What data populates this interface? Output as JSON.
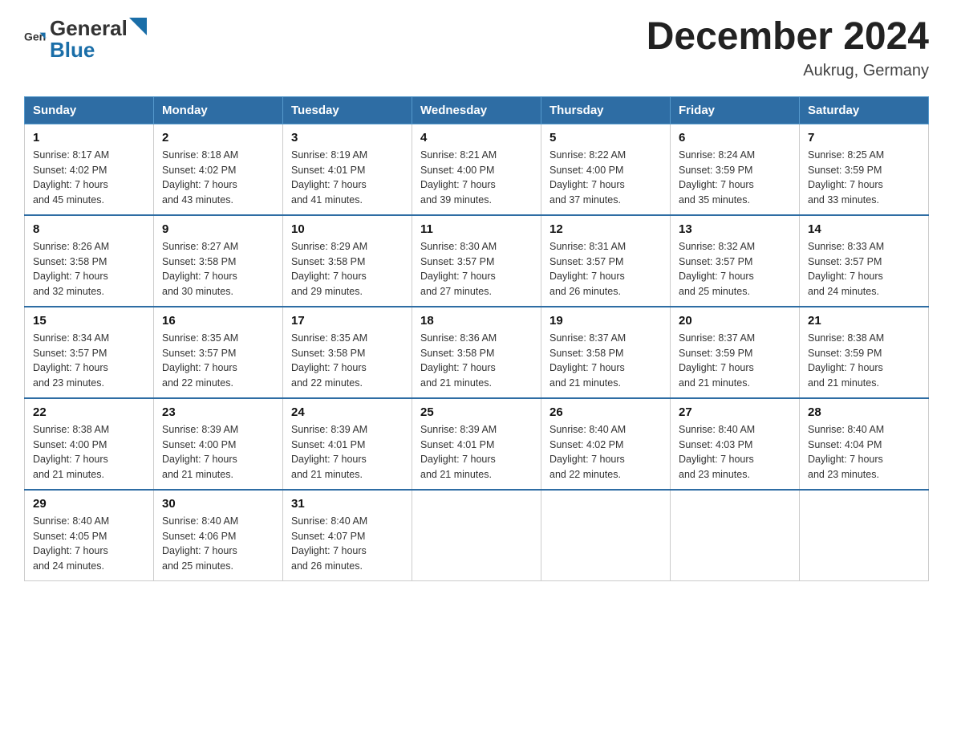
{
  "header": {
    "logo": {
      "text_general": "General",
      "text_blue": "Blue"
    },
    "title": "December 2024",
    "location": "Aukrug, Germany"
  },
  "days_of_week": [
    "Sunday",
    "Monday",
    "Tuesday",
    "Wednesday",
    "Thursday",
    "Friday",
    "Saturday"
  ],
  "weeks": [
    [
      {
        "day": "1",
        "sunrise": "8:17 AM",
        "sunset": "4:02 PM",
        "daylight": "7 hours and 45 minutes."
      },
      {
        "day": "2",
        "sunrise": "8:18 AM",
        "sunset": "4:02 PM",
        "daylight": "7 hours and 43 minutes."
      },
      {
        "day": "3",
        "sunrise": "8:19 AM",
        "sunset": "4:01 PM",
        "daylight": "7 hours and 41 minutes."
      },
      {
        "day": "4",
        "sunrise": "8:21 AM",
        "sunset": "4:00 PM",
        "daylight": "7 hours and 39 minutes."
      },
      {
        "day": "5",
        "sunrise": "8:22 AM",
        "sunset": "4:00 PM",
        "daylight": "7 hours and 37 minutes."
      },
      {
        "day": "6",
        "sunrise": "8:24 AM",
        "sunset": "3:59 PM",
        "daylight": "7 hours and 35 minutes."
      },
      {
        "day": "7",
        "sunrise": "8:25 AM",
        "sunset": "3:59 PM",
        "daylight": "7 hours and 33 minutes."
      }
    ],
    [
      {
        "day": "8",
        "sunrise": "8:26 AM",
        "sunset": "3:58 PM",
        "daylight": "7 hours and 32 minutes."
      },
      {
        "day": "9",
        "sunrise": "8:27 AM",
        "sunset": "3:58 PM",
        "daylight": "7 hours and 30 minutes."
      },
      {
        "day": "10",
        "sunrise": "8:29 AM",
        "sunset": "3:58 PM",
        "daylight": "7 hours and 29 minutes."
      },
      {
        "day": "11",
        "sunrise": "8:30 AM",
        "sunset": "3:57 PM",
        "daylight": "7 hours and 27 minutes."
      },
      {
        "day": "12",
        "sunrise": "8:31 AM",
        "sunset": "3:57 PM",
        "daylight": "7 hours and 26 minutes."
      },
      {
        "day": "13",
        "sunrise": "8:32 AM",
        "sunset": "3:57 PM",
        "daylight": "7 hours and 25 minutes."
      },
      {
        "day": "14",
        "sunrise": "8:33 AM",
        "sunset": "3:57 PM",
        "daylight": "7 hours and 24 minutes."
      }
    ],
    [
      {
        "day": "15",
        "sunrise": "8:34 AM",
        "sunset": "3:57 PM",
        "daylight": "7 hours and 23 minutes."
      },
      {
        "day": "16",
        "sunrise": "8:35 AM",
        "sunset": "3:57 PM",
        "daylight": "7 hours and 22 minutes."
      },
      {
        "day": "17",
        "sunrise": "8:35 AM",
        "sunset": "3:58 PM",
        "daylight": "7 hours and 22 minutes."
      },
      {
        "day": "18",
        "sunrise": "8:36 AM",
        "sunset": "3:58 PM",
        "daylight": "7 hours and 21 minutes."
      },
      {
        "day": "19",
        "sunrise": "8:37 AM",
        "sunset": "3:58 PM",
        "daylight": "7 hours and 21 minutes."
      },
      {
        "day": "20",
        "sunrise": "8:37 AM",
        "sunset": "3:59 PM",
        "daylight": "7 hours and 21 minutes."
      },
      {
        "day": "21",
        "sunrise": "8:38 AM",
        "sunset": "3:59 PM",
        "daylight": "7 hours and 21 minutes."
      }
    ],
    [
      {
        "day": "22",
        "sunrise": "8:38 AM",
        "sunset": "4:00 PM",
        "daylight": "7 hours and 21 minutes."
      },
      {
        "day": "23",
        "sunrise": "8:39 AM",
        "sunset": "4:00 PM",
        "daylight": "7 hours and 21 minutes."
      },
      {
        "day": "24",
        "sunrise": "8:39 AM",
        "sunset": "4:01 PM",
        "daylight": "7 hours and 21 minutes."
      },
      {
        "day": "25",
        "sunrise": "8:39 AM",
        "sunset": "4:01 PM",
        "daylight": "7 hours and 21 minutes."
      },
      {
        "day": "26",
        "sunrise": "8:40 AM",
        "sunset": "4:02 PM",
        "daylight": "7 hours and 22 minutes."
      },
      {
        "day": "27",
        "sunrise": "8:40 AM",
        "sunset": "4:03 PM",
        "daylight": "7 hours and 23 minutes."
      },
      {
        "day": "28",
        "sunrise": "8:40 AM",
        "sunset": "4:04 PM",
        "daylight": "7 hours and 23 minutes."
      }
    ],
    [
      {
        "day": "29",
        "sunrise": "8:40 AM",
        "sunset": "4:05 PM",
        "daylight": "7 hours and 24 minutes."
      },
      {
        "day": "30",
        "sunrise": "8:40 AM",
        "sunset": "4:06 PM",
        "daylight": "7 hours and 25 minutes."
      },
      {
        "day": "31",
        "sunrise": "8:40 AM",
        "sunset": "4:07 PM",
        "daylight": "7 hours and 26 minutes."
      },
      null,
      null,
      null,
      null
    ]
  ],
  "labels": {
    "sunrise": "Sunrise:",
    "sunset": "Sunset:",
    "daylight": "Daylight:"
  }
}
